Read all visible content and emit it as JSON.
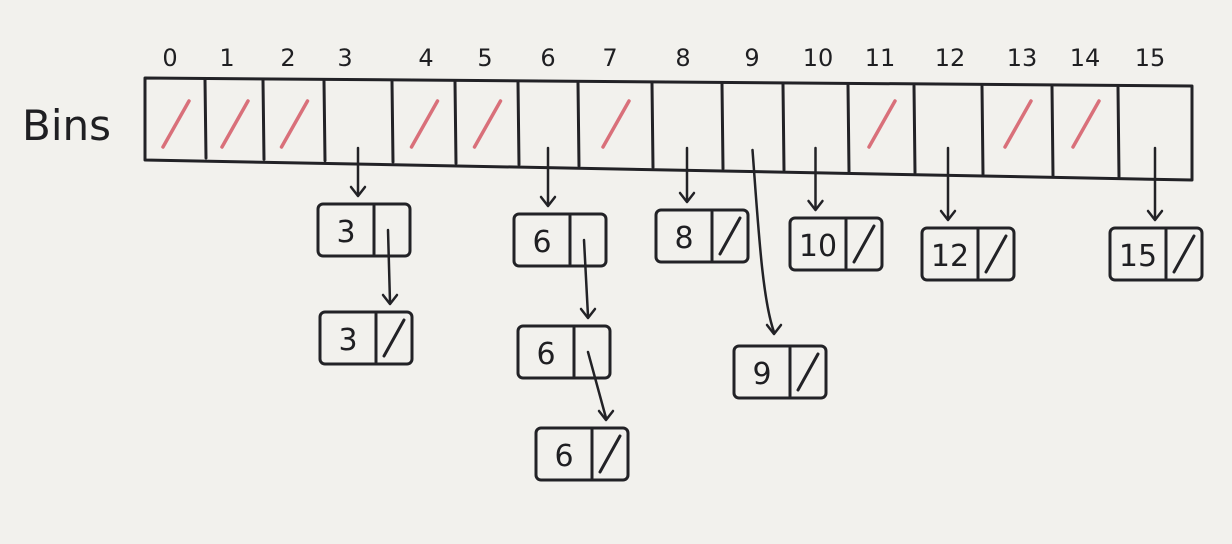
{
  "diagram": {
    "row_label": "Bins",
    "ink_color": "#222226",
    "empty_mark_color": "#d9707a",
    "bins": [
      {
        "index": "0",
        "empty": true
      },
      {
        "index": "1",
        "empty": true
      },
      {
        "index": "2",
        "empty": true
      },
      {
        "index": "3",
        "empty": false
      },
      {
        "index": "4",
        "empty": true
      },
      {
        "index": "5",
        "empty": true
      },
      {
        "index": "6",
        "empty": false
      },
      {
        "index": "7",
        "empty": true
      },
      {
        "index": "8",
        "empty": false
      },
      {
        "index": "9",
        "empty": false
      },
      {
        "index": "10",
        "empty": false
      },
      {
        "index": "11",
        "empty": true
      },
      {
        "index": "12",
        "empty": false
      },
      {
        "index": "13",
        "empty": true
      },
      {
        "index": "14",
        "empty": true
      },
      {
        "index": "15",
        "empty": false
      }
    ],
    "chains": [
      {
        "bin": "3",
        "nodes": [
          {
            "value": "3",
            "terminal": false
          },
          {
            "value": "3",
            "terminal": true
          }
        ]
      },
      {
        "bin": "6",
        "nodes": [
          {
            "value": "6",
            "terminal": false
          },
          {
            "value": "6",
            "terminal": false
          },
          {
            "value": "6",
            "terminal": true
          }
        ]
      },
      {
        "bin": "8",
        "nodes": [
          {
            "value": "8",
            "terminal": true
          }
        ]
      },
      {
        "bin": "9",
        "nodes": [
          {
            "value": "9",
            "terminal": true
          }
        ]
      },
      {
        "bin": "10",
        "nodes": [
          {
            "value": "10",
            "terminal": true
          }
        ]
      },
      {
        "bin": "12",
        "nodes": [
          {
            "value": "12",
            "terminal": true
          }
        ]
      },
      {
        "bin": "15",
        "nodes": [
          {
            "value": "15",
            "terminal": true
          }
        ]
      }
    ]
  }
}
